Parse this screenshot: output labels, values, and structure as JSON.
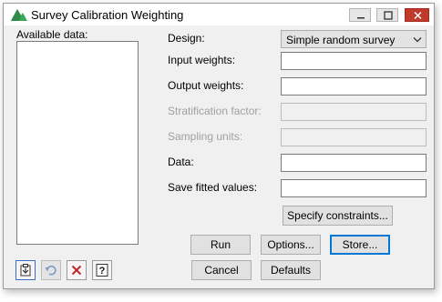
{
  "window": {
    "title": "Survey Calibration Weighting",
    "icons": {
      "app": "green-triangle-icon",
      "minimize": "minimize-icon",
      "maximize": "maximize-icon",
      "close": "close-icon"
    }
  },
  "available_data": {
    "label": "Available data:",
    "items": []
  },
  "form": {
    "design_label": "Design:",
    "design_value": "Simple random survey",
    "input_weights_label": "Input weights:",
    "input_weights_value": "",
    "output_weights_label": "Output weights:",
    "output_weights_value": "",
    "stratification_label": "Stratification factor:",
    "stratification_value": "",
    "sampling_units_label": "Sampling units:",
    "sampling_units_value": "",
    "data_label": "Data:",
    "data_value": "",
    "save_fitted_label": "Save fitted values:",
    "save_fitted_value": ""
  },
  "buttons": {
    "specify_constraints": "Specify constraints...",
    "run": "Run",
    "options": "Options...",
    "store": "Store...",
    "cancel": "Cancel",
    "defaults": "Defaults"
  },
  "toolbar": {
    "icons": [
      "clipboard-icon",
      "undo-icon",
      "clear-icon",
      "help-icon"
    ],
    "help_glyph": "?"
  },
  "colors": {
    "dialog_bg": "#f0f0f0",
    "close_button": "#c0392b",
    "focus_border": "#0078d7",
    "app_icon": "#3aa655",
    "clear_icon": "#c62828",
    "undo_icon": "#7a9cc6"
  }
}
